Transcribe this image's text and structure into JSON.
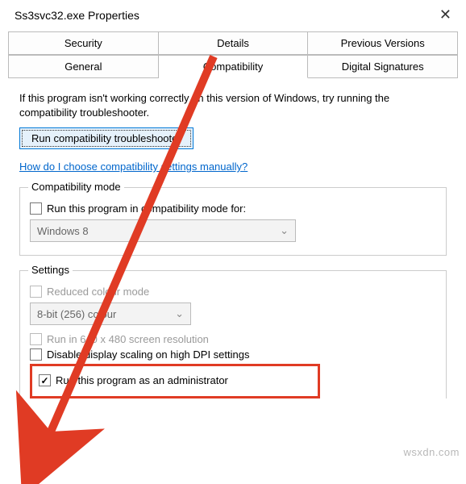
{
  "window": {
    "title": "Ss3svc32.exe Properties"
  },
  "tabs": {
    "row1": [
      "Security",
      "Details",
      "Previous Versions"
    ],
    "row2": [
      "General",
      "Compatibility",
      "Digital Signatures"
    ],
    "active": "Compatibility"
  },
  "intro": "If this program isn't working correctly on this version of Windows, try running the compatibility troubleshooter.",
  "troubleshooter_button": "Run compatibility troubleshooter",
  "help_link": "How do I choose compatibility settings manually?",
  "compat_mode": {
    "group_label": "Compatibility mode",
    "checkbox_label": "Run this program in compatibility mode for:",
    "dropdown_value": "Windows 8"
  },
  "settings": {
    "group_label": "Settings",
    "reduced_colour": "Reduced colour mode",
    "colour_dropdown": "8-bit (256) colour",
    "lowres": "Run in 640 x 480 screen resolution",
    "dpi_scaling": "Disable display scaling on high DPI settings",
    "run_admin": "Run this program as an administrator"
  },
  "watermark": "wsxdn.com"
}
